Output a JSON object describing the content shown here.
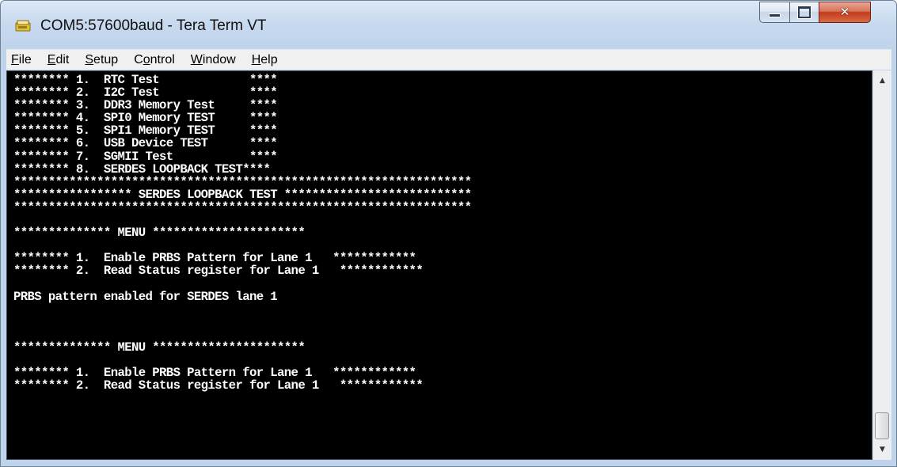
{
  "window": {
    "title": "COM5:57600baud - Tera Term VT"
  },
  "menubar": {
    "items": [
      {
        "accel": "F",
        "rest": "ile"
      },
      {
        "accel": "E",
        "rest": "dit"
      },
      {
        "accel": "S",
        "rest": "etup"
      },
      {
        "pre": "C",
        "accel": "o",
        "rest": "ntrol"
      },
      {
        "accel": "W",
        "rest": "indow"
      },
      {
        "accel": "H",
        "rest": "elp"
      }
    ]
  },
  "terminal": {
    "lines": [
      "******** 1.  RTC Test             ****",
      "******** 2.  I2C Test             ****",
      "******** 3.  DDR3 Memory Test     ****",
      "******** 4.  SPI0 Memory TEST     ****",
      "******** 5.  SPI1 Memory TEST     ****",
      "******** 6.  USB Device TEST      ****",
      "******** 7.  SGMII Test           ****",
      "******** 8.  SERDES LOOPBACK TEST****",
      "******************************************************************",
      "***************** SERDES LOOPBACK TEST ***************************",
      "******************************************************************",
      "",
      "************** MENU **********************",
      "",
      "******** 1.  Enable PRBS Pattern for Lane 1   ************",
      "******** 2.  Read Status register for Lane 1   ************",
      "",
      "PRBS pattern enabled for SERDES lane 1",
      "",
      "",
      "",
      "************** MENU **********************",
      "",
      "******** 1.  Enable PRBS Pattern for Lane 1   ************",
      "******** 2.  Read Status register for Lane 1   ************"
    ]
  },
  "icons": {
    "app": "tera-term-icon",
    "minimize": "minimize-icon",
    "maximize": "maximize-icon",
    "close": "close-icon"
  },
  "colors": {
    "terminal_bg": "#000000",
    "terminal_fg": "#ffffff",
    "close_button": "#c8442a"
  },
  "scrollbar": {
    "position": 0.93
  }
}
